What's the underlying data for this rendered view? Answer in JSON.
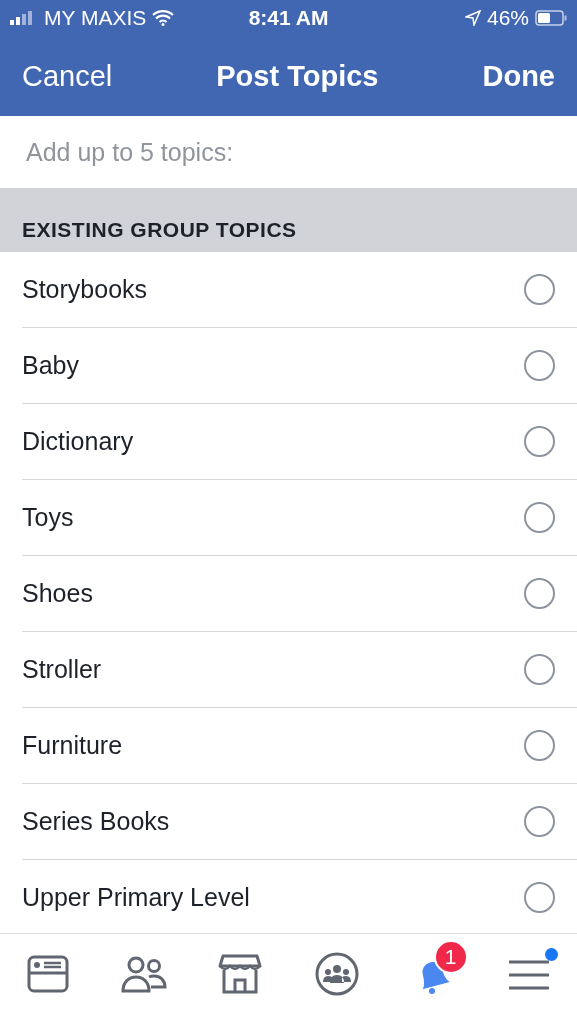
{
  "status_bar": {
    "carrier": "MY MAXIS",
    "time": "8:41 AM",
    "battery": "46%"
  },
  "nav": {
    "cancel": "Cancel",
    "title": "Post Topics",
    "done": "Done"
  },
  "topics_field": {
    "placeholder": "Add up to 5 topics:"
  },
  "section": {
    "title": "EXISTING GROUP TOPICS"
  },
  "topics": [
    {
      "label": "Storybooks",
      "selected": false
    },
    {
      "label": "Baby",
      "selected": false
    },
    {
      "label": "Dictionary",
      "selected": false
    },
    {
      "label": "Toys",
      "selected": false
    },
    {
      "label": "Shoes",
      "selected": false
    },
    {
      "label": "Stroller",
      "selected": false
    },
    {
      "label": "Furniture",
      "selected": false
    },
    {
      "label": "Series Books",
      "selected": false
    },
    {
      "label": "Upper Primary Level",
      "selected": false
    }
  ],
  "tab_bar": [
    {
      "kind": "news",
      "selected": false
    },
    {
      "kind": "friends",
      "selected": false
    },
    {
      "kind": "market",
      "selected": false
    },
    {
      "kind": "groups",
      "selected": false
    },
    {
      "kind": "bell",
      "selected": true,
      "badge": "1"
    },
    {
      "kind": "menu",
      "selected": false,
      "dot": true
    }
  ]
}
